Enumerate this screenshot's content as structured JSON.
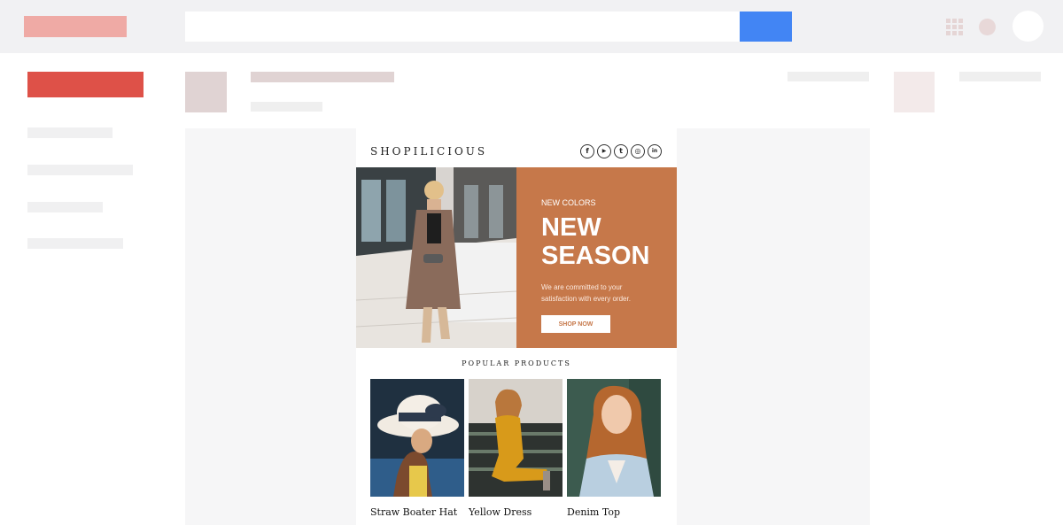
{
  "email": {
    "brand": "SHOPILICIOUS",
    "social_icons": [
      {
        "name": "facebook-icon",
        "glyph": "f"
      },
      {
        "name": "youtube-icon",
        "glyph": "▶"
      },
      {
        "name": "twitter-icon",
        "glyph": "t"
      },
      {
        "name": "instagram-icon",
        "glyph": "◎"
      },
      {
        "name": "linkedin-icon",
        "glyph": "in"
      }
    ],
    "hero": {
      "kicker": "NEW COLORS",
      "title_line1": "NEW",
      "title_line2": "SEASON",
      "body": "We are committed to your satisfaction with every order.",
      "button_label": "SHOP NOW"
    },
    "popular_title": "POPULAR PRODUCTS",
    "products": [
      {
        "name": "Straw Boater Hat"
      },
      {
        "name": "Yellow Dress"
      },
      {
        "name": "Denim Top"
      }
    ]
  },
  "colors": {
    "brand_accent": "#c6784a",
    "primary_button": "#4285f4",
    "compose_button": "#de5148",
    "topbar_bg": "#f1f1f3"
  }
}
